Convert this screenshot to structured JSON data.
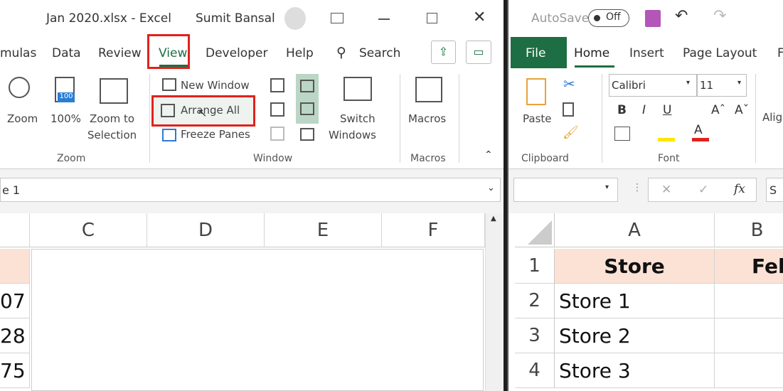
{
  "left": {
    "title": "Jan 2020.xlsx  -  Excel",
    "user": "Sumit Bansal",
    "tabs": [
      "mulas",
      "Data",
      "Review",
      "View",
      "Developer",
      "Help"
    ],
    "search": "Search",
    "ribbon": {
      "zoom": "Zoom",
      "zoom100": "100%",
      "zoom_to_1": "Zoom to",
      "zoom_to_2": "Selection",
      "zoom_group": "Zoom",
      "new_window": "New Window",
      "arrange_all": "Arrange All",
      "freeze_panes": "Freeze Panes",
      "switch_1": "Switch",
      "switch_2": "Windows",
      "window_group": "Window",
      "macros": "Macros",
      "macros_group": "Macros"
    },
    "name_box": "e 1",
    "columns": [
      "C",
      "D",
      "E",
      "F"
    ],
    "cells": [
      "07",
      "28",
      "75"
    ],
    "highlight": "#e2211c"
  },
  "right": {
    "autosave": "AutoSave",
    "toggle": "Off",
    "tabs": [
      "File",
      "Home",
      "Insert",
      "Page Layout",
      "F"
    ],
    "ribbon": {
      "paste": "Paste",
      "clipboard": "Clipboard",
      "font": "Calibri",
      "size": "11",
      "font_group": "Font",
      "align": "Alig",
      "bold": "B",
      "italic": "I",
      "underline": "U"
    },
    "formula_fx": "fx",
    "formula_value": "S",
    "columns": [
      "A",
      "B"
    ],
    "rows": [
      {
        "num": "1",
        "a": "Store",
        "b": "Fel"
      },
      {
        "num": "2",
        "a": "Store 1",
        "b": ""
      },
      {
        "num": "3",
        "a": "Store 2",
        "b": ""
      },
      {
        "num": "4",
        "a": "Store 3",
        "b": ""
      }
    ],
    "header_fill": "#fbe2d5",
    "accent": "#1e6e43"
  }
}
